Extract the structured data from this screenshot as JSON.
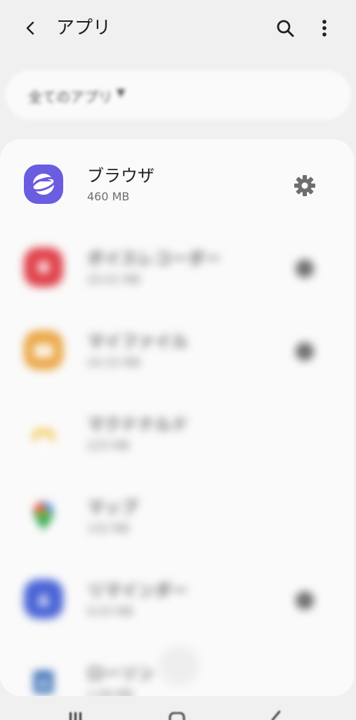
{
  "header": {
    "title": "アプリ",
    "back_icon": "chevron-left-icon",
    "search_icon": "search-icon",
    "more_icon": "more-vert-icon"
  },
  "filter": {
    "label": "全てのアプリ",
    "caret_icon": "caret-down-icon"
  },
  "apps": [
    {
      "name": "ブラウザ",
      "size": "460 MB",
      "icon": "samsung-internet-icon",
      "color": "#6a5de0",
      "has_settings": true
    },
    {
      "name": "ボイスレコーダー",
      "size": "20.01 MB",
      "icon": "voice-recorder-icon",
      "color": "#e0424c",
      "has_settings": true
    },
    {
      "name": "マイファイル",
      "size": "24.33 MB",
      "icon": "my-files-icon",
      "color": "#eaa645",
      "has_settings": true
    },
    {
      "name": "マクドナルド",
      "size": "225 MB",
      "icon": "mcdonalds-icon",
      "color": "#f5c242",
      "has_settings": false
    },
    {
      "name": "マップ",
      "size": "132 MB",
      "icon": "google-maps-icon",
      "color": "#34a853",
      "has_settings": false
    },
    {
      "name": "リマインダー",
      "size": "9.03 MB",
      "icon": "reminder-icon",
      "color": "#4a64d6",
      "has_settings": true
    },
    {
      "name": "ローソン",
      "size": "1.06 MB",
      "icon": "lawson-icon",
      "color": "#3a6fb5",
      "has_settings": false
    }
  ],
  "settings_icon": "gear-icon",
  "navbar": {
    "recent_icon": "recent-apps-icon",
    "home_icon": "home-icon",
    "back_icon": "back-icon"
  }
}
